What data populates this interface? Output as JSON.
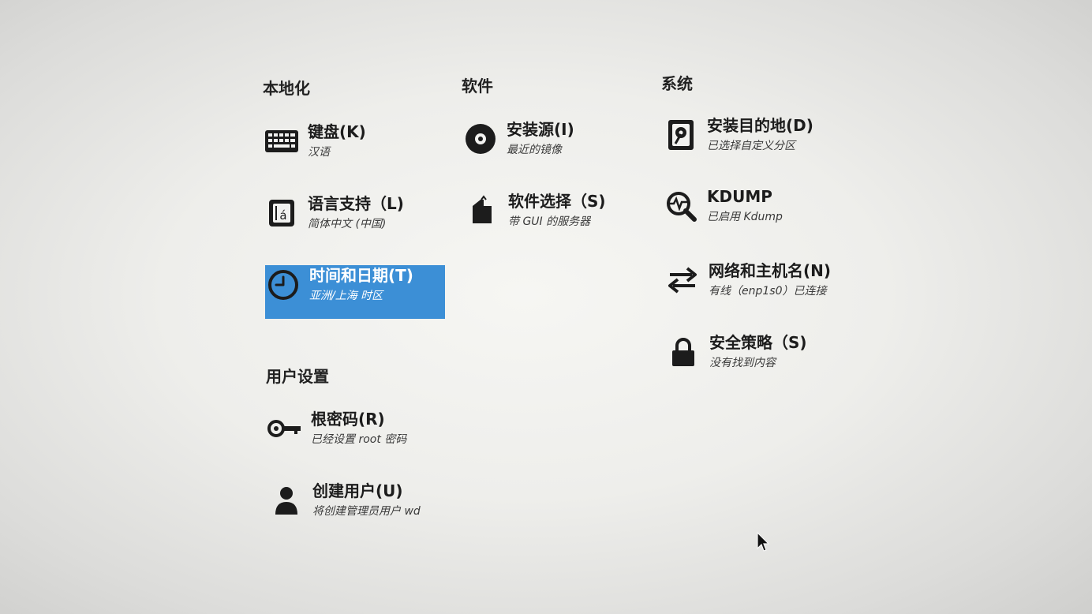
{
  "sections": {
    "localization": "本地化",
    "software": "软件",
    "system": "系统",
    "user_settings": "用户设置"
  },
  "spokes": {
    "keyboard": {
      "title": "键盘(K)",
      "status": "汉语",
      "icon": "keyboard-icon"
    },
    "language": {
      "title": "语言支持（L)",
      "status": "简体中文 (中国)",
      "icon": "language-icon"
    },
    "datetime": {
      "title": "时间和日期(T)",
      "status": "亚洲/上海 时区",
      "icon": "clock-icon",
      "selected": true
    },
    "source": {
      "title": "安装源(I)",
      "status": "最近的镜像",
      "icon": "disc-icon"
    },
    "software_selection": {
      "title": "软件选择（S)",
      "status": "带 GUI 的服务器",
      "icon": "package-icon"
    },
    "destination": {
      "title": "安装目的地(D)",
      "status": "已选择自定义分区",
      "icon": "disk-icon"
    },
    "kdump": {
      "title": "KDUMP",
      "status": "已启用 Kdump",
      "icon": "kdump-search-icon"
    },
    "network": {
      "title": "网络和主机名(N)",
      "status": "有线（enp1s0）已连接",
      "icon": "network-arrows-icon"
    },
    "security": {
      "title": "安全策略（S)",
      "status": "没有找到内容",
      "icon": "lock-icon"
    },
    "root_password": {
      "title": "根密码(R)",
      "status": "已经设置 root 密码",
      "icon": "key-icon"
    },
    "create_user": {
      "title": "创建用户(U)",
      "status": "将创建管理员用户 wd",
      "icon": "user-icon"
    }
  },
  "colors": {
    "selected": "#3c8fd6",
    "text": "#1c1c1c",
    "status": "#3a3a3a"
  }
}
